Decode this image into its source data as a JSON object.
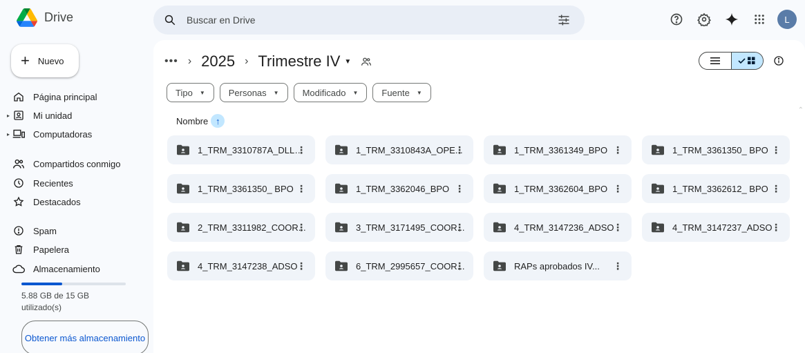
{
  "header": {
    "app_name": "Drive",
    "search_placeholder": "Buscar en Drive",
    "avatar_letter": "L"
  },
  "sidebar": {
    "new_label": "Nuevo",
    "items": [
      {
        "label": "Página principal",
        "icon": "home-icon"
      },
      {
        "label": "Mi unidad",
        "icon": "my-drive-icon"
      },
      {
        "label": "Computadoras",
        "icon": "computer-icon"
      },
      {
        "label": "Compartidos conmigo",
        "icon": "shared-icon"
      },
      {
        "label": "Recientes",
        "icon": "clock-icon"
      },
      {
        "label": "Destacados",
        "icon": "star-icon"
      },
      {
        "label": "Spam",
        "icon": "spam-icon"
      },
      {
        "label": "Papelera",
        "icon": "trash-icon"
      },
      {
        "label": "Almacenamiento",
        "icon": "cloud-icon"
      }
    ],
    "storage_used_fraction": 0.392,
    "storage_text": "5.88 GB de 15 GB utilizado(s)",
    "more_storage_label": "Obtener más almacenamiento"
  },
  "main": {
    "breadcrumb": {
      "more": "•••",
      "parent": "2025",
      "current": "Trimestre IV"
    },
    "filters": [
      "Tipo",
      "Personas",
      "Modificado",
      "Fuente"
    ],
    "sort_label": "Nombre",
    "folders": [
      "1_TRM_3310787A_DLLO...",
      "1_TRM_3310843A_OPE...",
      "1_TRM_3361349_BPO",
      "1_TRM_3361350_ BPO",
      "1_TRM_3361350_ BPO",
      "1_TRM_3362046_BPO",
      "1_TRM_3362604_BPO",
      "1_TRM_3362612_ BPO",
      "2_TRM_3311982_COOR...",
      "3_TRM_3171495_COOR...",
      "4_TRM_3147236_ADSO",
      "4_TRM_3147237_ADSO",
      "4_TRM_3147238_ADSO",
      "6_TRM_2995657_COOR...",
      "RAPs aprobados IV..."
    ]
  },
  "colors": {
    "accent": "#0b57d0",
    "chip_selected": "#c2e7ff",
    "folder_bg": "#f0f4f9",
    "page_bg": "#f8fafd"
  }
}
